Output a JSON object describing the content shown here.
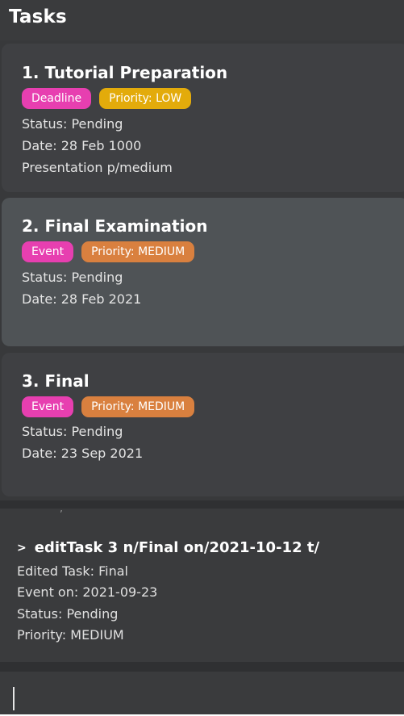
{
  "header": {
    "title": "Tasks"
  },
  "tasks": [
    {
      "title": "1.  Tutorial Preparation",
      "type": "Deadline",
      "priority": "Priority: LOW",
      "status": "Status: Pending",
      "date": "Date: 28 Feb 1000",
      "description": "Presentation p/medium"
    },
    {
      "title": "2.  Final Examination",
      "type": "Event",
      "priority": "Priority: MEDIUM",
      "status": "Status: Pending",
      "date": "Date: 28 Feb 2021"
    },
    {
      "title": "3.  Final",
      "type": "Event",
      "priority": "Priority: MEDIUM",
      "status": "Status: Pending",
      "date": "Date: 23 Sep 2021"
    }
  ],
  "result": {
    "tick": "’",
    "prompt": ">",
    "command": "editTask 3 n/Final on/2021-10-12 t/",
    "lines": [
      "Edited Task: Final",
      "Event on: 2021-09-23",
      "Status: Pending",
      "Priority: MEDIUM"
    ]
  },
  "command_box": {
    "value": "",
    "placeholder": ""
  },
  "colors": {
    "type_tag": "#e73fb0",
    "priority_low": "#e3ab0b",
    "priority_medium": "#d9803f",
    "selected_card": "#4f5356",
    "card": "#3f4043",
    "background": "#3a3b3d"
  }
}
